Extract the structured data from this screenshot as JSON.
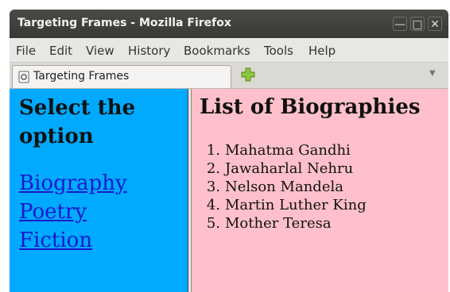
{
  "window": {
    "title": "Targeting Frames - Mozilla Firefox",
    "buttons": [
      "minimize",
      "maximize",
      "close"
    ]
  },
  "menubar": {
    "items": [
      "File",
      "Edit",
      "View",
      "History",
      "Bookmarks",
      "Tools",
      "Help"
    ]
  },
  "tabs": [
    {
      "label": "Targeting Frames",
      "icon": "page-icon"
    }
  ],
  "left_frame": {
    "heading_line1": "Select the",
    "heading_line2": "option",
    "links": [
      "Biography",
      "Poetry",
      "Fiction"
    ],
    "background": "#00aaff"
  },
  "right_frame": {
    "heading": "List of Biographies",
    "items": [
      "Mahatma Gandhi",
      "Jawaharlal Nehru",
      "Nelson Mandela",
      "Martin Luther King",
      "Mother Teresa"
    ],
    "background": "#ffc0cb"
  },
  "colors": {
    "link": "#1a1acc",
    "titlebar": "#3c3c39"
  }
}
